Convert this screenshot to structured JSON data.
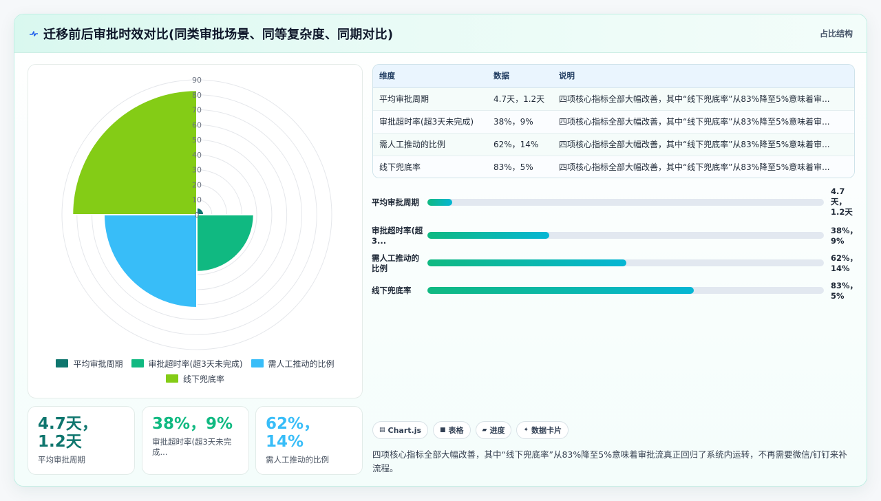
{
  "header": {
    "icon": "pulse-icon",
    "title": "迁移前后审批时效对比(同类审批场景、同等复杂度、同期对比)",
    "tag": "占比结构"
  },
  "chart_data": {
    "type": "polarArea",
    "categories": [
      "平均审批周期",
      "审批超时率(超3天未完成)",
      "需人工推动的比例",
      "线下兜底率"
    ],
    "values": [
      4.7,
      38,
      62,
      83
    ],
    "colors": [
      "#0f766e",
      "#10b981",
      "#38bdf8",
      "#84cc16"
    ],
    "r_ticks": [
      "0",
      "10",
      "20",
      "30",
      "40",
      "50",
      "60",
      "70",
      "80",
      "90"
    ],
    "r_range": [
      0,
      90
    ],
    "grid": true,
    "legend_position": "bottom"
  },
  "stats": [
    {
      "value": "4.7天，1.2天",
      "label": "平均审批周期",
      "color": "#0f766e"
    },
    {
      "value": "38%，9%",
      "label": "审批超时率(超3天未完成...",
      "color": "#10b981"
    },
    {
      "value": "62%，14%",
      "label": "需人工推动的比例",
      "color": "#38bdf8"
    }
  ],
  "table": {
    "headers": [
      "维度",
      "数据",
      "说明"
    ],
    "rows": [
      [
        "平均审批周期",
        "4.7天，1.2天",
        "四项核心指标全部大幅改善，其中“线下兜底率”从83%降至5%意味着审..."
      ],
      [
        "审批超时率(超3天未完成)",
        "38%，9%",
        "四项核心指标全部大幅改善，其中“线下兜底率”从83%降至5%意味着审..."
      ],
      [
        "需人工推动的比例",
        "62%，14%",
        "四项核心指标全部大幅改善，其中“线下兜底率”从83%降至5%意味着审..."
      ],
      [
        "线下兜底率",
        "83%，5%",
        "四项核心指标全部大幅改善，其中“线下兜底率”从83%降至5%意味着审..."
      ]
    ]
  },
  "progress": [
    {
      "label": "平均审批周期",
      "value": "4.7天，1.2天",
      "fraction": 0.062
    },
    {
      "label": "审批超时率(超3...",
      "value": "38%，9%",
      "fraction": 0.307
    },
    {
      "label": "需人工推动的比例",
      "value": "62%，14%",
      "fraction": 0.501
    },
    {
      "label": "线下兜底率",
      "value": "83%，5%",
      "fraction": 0.672
    }
  ],
  "chips": [
    {
      "icon": "chart-icon",
      "glyph": "▤",
      "label": "Chart.js"
    },
    {
      "icon": "table-icon",
      "glyph": "■",
      "label": "表格"
    },
    {
      "icon": "progress-icon",
      "glyph": "▰",
      "label": "进度"
    },
    {
      "icon": "card-icon",
      "glyph": "✦",
      "label": "数据卡片"
    }
  ],
  "note": "四项核心指标全部大幅改善，其中“线下兜底率”从83%降至5%意味着审批流真正回归了系统内运转，不再需要微信/钉钉来补流程。"
}
